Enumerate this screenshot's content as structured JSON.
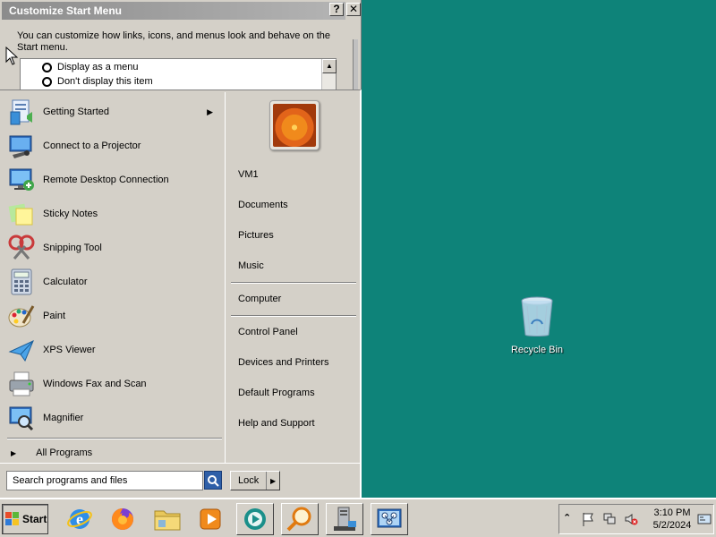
{
  "dialog": {
    "title": "Customize Start Menu",
    "help_btn": "?",
    "close_btn": "✕",
    "description": "You can customize how links, icons, and menus look and behave on the Start menu.",
    "options": [
      {
        "label": "Display as a menu"
      },
      {
        "label": "Don't display this item"
      }
    ]
  },
  "start_menu": {
    "programs": [
      {
        "label": "Getting Started",
        "icon": "getting-started-icon",
        "has_submenu": true
      },
      {
        "label": "Connect to a Projector",
        "icon": "projector-icon"
      },
      {
        "label": "Remote Desktop Connection",
        "icon": "remote-desktop-icon"
      },
      {
        "label": "Sticky Notes",
        "icon": "sticky-notes-icon"
      },
      {
        "label": "Snipping Tool",
        "icon": "snipping-tool-icon"
      },
      {
        "label": "Calculator",
        "icon": "calculator-icon"
      },
      {
        "label": "Paint",
        "icon": "paint-icon"
      },
      {
        "label": "XPS Viewer",
        "icon": "xps-viewer-icon"
      },
      {
        "label": "Windows Fax and Scan",
        "icon": "fax-scan-icon"
      },
      {
        "label": "Magnifier",
        "icon": "magnifier-icon"
      }
    ],
    "all_programs": "All Programs",
    "right_items": {
      "user": "VM1",
      "documents": "Documents",
      "pictures": "Pictures",
      "music": "Music",
      "computer": "Computer",
      "control_panel": "Control Panel",
      "devices": "Devices and Printers",
      "default_programs": "Default Programs",
      "help": "Help and Support"
    },
    "search_placeholder": "Search programs and files",
    "lock_label": "Lock"
  },
  "desktop": {
    "recycle_bin": "Recycle Bin"
  },
  "taskbar": {
    "start_label": "Start",
    "pinned": [
      {
        "icon": "internet-explorer-icon"
      },
      {
        "icon": "firefox-icon"
      },
      {
        "icon": "file-explorer-icon"
      },
      {
        "icon": "media-player-icon"
      },
      {
        "icon": "remote-app-icon"
      },
      {
        "icon": "search-app-icon"
      },
      {
        "icon": "server-manager-icon"
      },
      {
        "icon": "network-app-icon"
      }
    ],
    "clock_time": "3:10 PM",
    "clock_date": "5/2/2024"
  },
  "colors": {
    "desktop": "#0e8379",
    "chrome": "#d4d0c8",
    "accent": "#2e5fa8"
  }
}
